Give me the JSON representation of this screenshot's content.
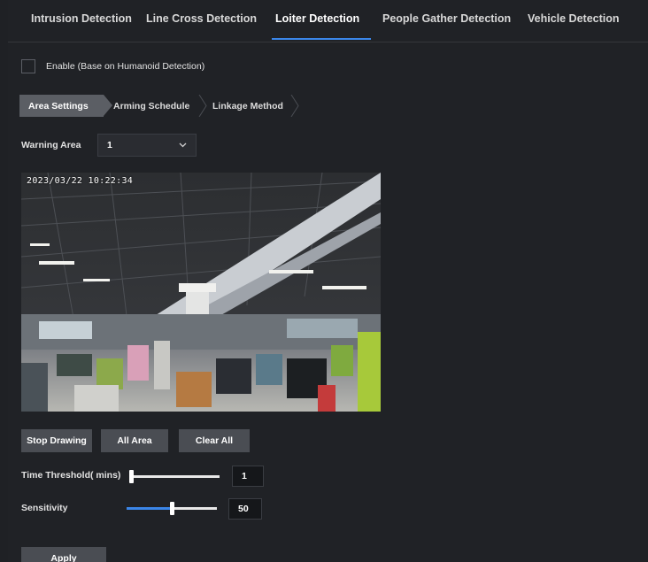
{
  "tabs": [
    {
      "label": "Intrusion Detection",
      "active": false
    },
    {
      "label": "Line Cross Detection",
      "active": false
    },
    {
      "label": "Loiter Detection",
      "active": true
    },
    {
      "label": "People Gather Detection",
      "active": false
    },
    {
      "label": "Vehicle Detection",
      "active": false
    }
  ],
  "enable": {
    "label": "Enable (Base on Humanoid Detection)",
    "checked": false
  },
  "steps": [
    {
      "label": "Area Settings",
      "active": true
    },
    {
      "label": "Arming Schedule",
      "active": false
    },
    {
      "label": "Linkage Method",
      "active": false
    }
  ],
  "warning_area": {
    "label": "Warning Area",
    "value": "1"
  },
  "video": {
    "osd_time": "2023/03/22 10:22:34"
  },
  "buttons": {
    "stop_drawing": "Stop Drawing",
    "all_area": "All Area",
    "clear_all": "Clear All",
    "apply": "Apply"
  },
  "time_threshold": {
    "label": "Time Threshold( mins)",
    "value": "1",
    "fraction": 0.0
  },
  "sensitivity": {
    "label": "Sensitivity",
    "value": "50",
    "fraction": 0.5
  },
  "colors": {
    "accent": "#3b86e8",
    "background": "#202226",
    "button": "#4a4d53"
  }
}
